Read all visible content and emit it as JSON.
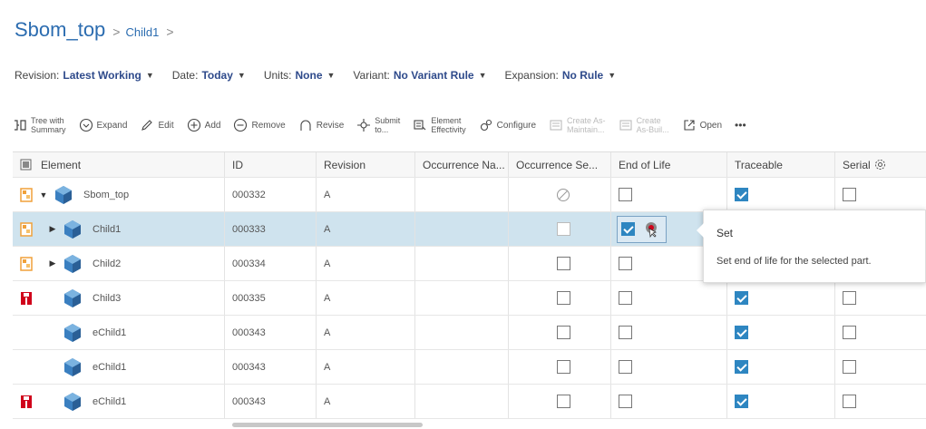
{
  "title": "Sbom_top",
  "breadcrumb": [
    ">",
    "Child1",
    ">"
  ],
  "filters": [
    {
      "label": "Revision:",
      "value": "Latest Working"
    },
    {
      "label": "Date:",
      "value": "Today"
    },
    {
      "label": "Units:",
      "value": "None"
    },
    {
      "label": "Variant:",
      "value": "No Variant Rule"
    },
    {
      "label": "Expansion:",
      "value": "No Rule"
    }
  ],
  "toolbar": {
    "tree_line1": "Tree with",
    "tree_line2": "Summary",
    "expand": "Expand",
    "edit": "Edit",
    "add": "Add",
    "remove": "Remove",
    "revise": "Revise",
    "submit_line1": "Submit",
    "submit_line2": "to...",
    "element_line1": "Element",
    "element_line2": "Effectivity",
    "configure": "Configure",
    "create_asm_line1": "Create As-",
    "create_asm_line2": "Maintain...",
    "create_asb_line1": "Create",
    "create_asb_line2": "As-Buil...",
    "open": "Open",
    "more": "•••"
  },
  "columns": {
    "element": "Element",
    "id": "ID",
    "revision": "Revision",
    "occ_name": "Occurrence Na...",
    "occ_seq": "Occurrence Se...",
    "eol": "End of Life",
    "traceable": "Traceable",
    "serial": "Serial"
  },
  "rows": [
    {
      "name": "Sbom_top",
      "id": "000332",
      "rev": "A"
    },
    {
      "name": "Child1",
      "id": "000333",
      "rev": "A"
    },
    {
      "name": "Child2",
      "id": "000334",
      "rev": "A"
    },
    {
      "name": "Child3",
      "id": "000335",
      "rev": "A"
    },
    {
      "name": "eChild1",
      "id": "000343",
      "rev": "A"
    },
    {
      "name": "eChild1",
      "id": "000343",
      "rev": "A"
    },
    {
      "name": "eChild1",
      "id": "000343",
      "rev": "A"
    }
  ],
  "tooltip": {
    "title": "Set",
    "description": "Set end of life for the selected part."
  },
  "colors": {
    "title": "#2b6cb0",
    "selected_row": "#cfe3ee",
    "checkbox_checked": "#2e86c1",
    "status_orange": "#f0a13a",
    "status_red": "#d0021b",
    "cube_blue": "#3a7fc0"
  }
}
